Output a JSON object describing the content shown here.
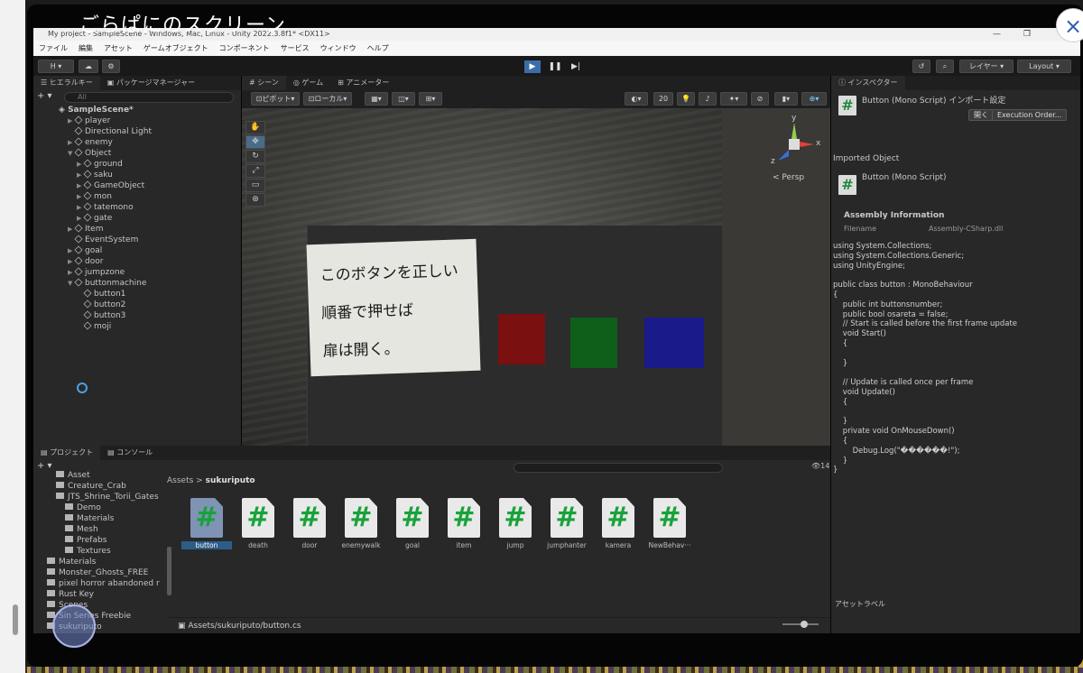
{
  "overlay": {
    "banner": "ごらぱにのスクリーン",
    "close_icon": "×"
  },
  "window": {
    "title": "My project - SampleScene - Windows, Mac, Linux - Unity 2022.3.8f1* <DX11>",
    "min": "—",
    "max": "❐",
    "close": "✕"
  },
  "menu": [
    "ファイル",
    "編集",
    "アセット",
    "ゲームオブジェクト",
    "コンポーネント",
    "サービス",
    "ウィンドウ",
    "ヘルプ"
  ],
  "toolbar": {
    "account": "H ▾",
    "layers": "レイヤー",
    "layout": "Layout"
  },
  "hierarchy": {
    "tabs": [
      "ヒエラルキー",
      "パッケージマネージャー"
    ],
    "search_placeholder": "All",
    "add": "+ ▾",
    "scene": "SampleScene*",
    "items": [
      {
        "label": "player",
        "arrow": "▶"
      },
      {
        "label": "Directional Light",
        "arrow": ""
      },
      {
        "label": "enemy",
        "arrow": "▶"
      },
      {
        "label": "Object",
        "arrow": "▼"
      },
      {
        "label": "ground",
        "arrow": "▶"
      },
      {
        "label": "saku",
        "arrow": "▶"
      },
      {
        "label": "GameObject",
        "arrow": "▶"
      },
      {
        "label": "mon",
        "arrow": "▶"
      },
      {
        "label": "tatemono",
        "arrow": "▶"
      },
      {
        "label": "gate",
        "arrow": "▶"
      },
      {
        "label": "Item",
        "arrow": "▶"
      },
      {
        "label": "EventSystem",
        "arrow": ""
      },
      {
        "label": "goal",
        "arrow": "▶"
      },
      {
        "label": "door",
        "arrow": "▶"
      },
      {
        "label": "jumpzone",
        "arrow": "▶"
      },
      {
        "label": "buttonmachine",
        "arrow": "▼"
      },
      {
        "label": "button1",
        "arrow": ""
      },
      {
        "label": "button2",
        "arrow": ""
      },
      {
        "label": "button3",
        "arrow": ""
      },
      {
        "label": "moji",
        "arrow": ""
      }
    ]
  },
  "scene_view": {
    "tabs": [
      "シーン",
      "ゲーム",
      "アニメーター"
    ],
    "pivot": "ピボット",
    "local": "ローカル",
    "num_label": "20",
    "persp": "< Persp",
    "sign_lines": [
      "このボタンを正しい",
      "順番で押せば",
      "扉は開く。"
    ],
    "cube_colors": [
      "#7a1010",
      "#0f5e1a",
      "#1a1a8a"
    ],
    "gizmo": {
      "y": "y",
      "x": "x",
      "z": "z"
    }
  },
  "project": {
    "tabs": [
      "プロジェクト",
      "コンソール"
    ],
    "add": "+ ▾",
    "count": "14",
    "breadcrumb_root": "Assets",
    "breadcrumb_sep": ">",
    "breadcrumb_current": "sukuriputo",
    "folders": [
      {
        "label": "Asset"
      },
      {
        "label": "Creature_Crab"
      },
      {
        "label": "JTS_Shrine_Torii_Gates"
      },
      {
        "label": "Demo"
      },
      {
        "label": "Materials"
      },
      {
        "label": "Mesh"
      },
      {
        "label": "Prefabs"
      },
      {
        "label": "Textures"
      },
      {
        "label": "Materials"
      },
      {
        "label": "Monster_Ghosts_FREE"
      },
      {
        "label": "pixel horror abandoned r"
      },
      {
        "label": "Rust Key"
      },
      {
        "label": "Scenes"
      },
      {
        "label": "Sin Series Freebie"
      },
      {
        "label": "sukuriputo"
      }
    ],
    "assets": [
      {
        "name": "button"
      },
      {
        "name": "death"
      },
      {
        "name": "door"
      },
      {
        "name": "enemywalk"
      },
      {
        "name": "goal"
      },
      {
        "name": "item"
      },
      {
        "name": "jump"
      },
      {
        "name": "jumphanter"
      },
      {
        "name": "kamera"
      },
      {
        "name": "NewBehav···"
      }
    ],
    "asset_glyph": "#",
    "path": "Assets/sukuriputo/button.cs"
  },
  "inspector": {
    "tab": "インスペクター",
    "header_title": "Button (Mono Script) インポート設定",
    "open": "開く",
    "exec_order": "Execution Order...",
    "imported_object": "Imported Object",
    "script_title": "Button (Mono Script)",
    "assembly_info": "Assembly Information",
    "filename_label": "Filename",
    "filename_value": "Assembly-CSharp.dll",
    "code": "using System.Collections;\nusing System.Collections.Generic;\nusing UnityEngine;\n\npublic class button : MonoBehaviour\n{\n    public int buttonsnumber;\n    public bool osareta = false;\n    // Start is called before the first frame update\n    void Start()\n    {\n\n    }\n\n    // Update is called once per frame\n    void Update()\n    {\n\n    }\n    private void OnMouseDown()\n    {\n        Debug.Log(\"������!\");\n    }\n}",
    "asset_label": "アセットラベル"
  }
}
